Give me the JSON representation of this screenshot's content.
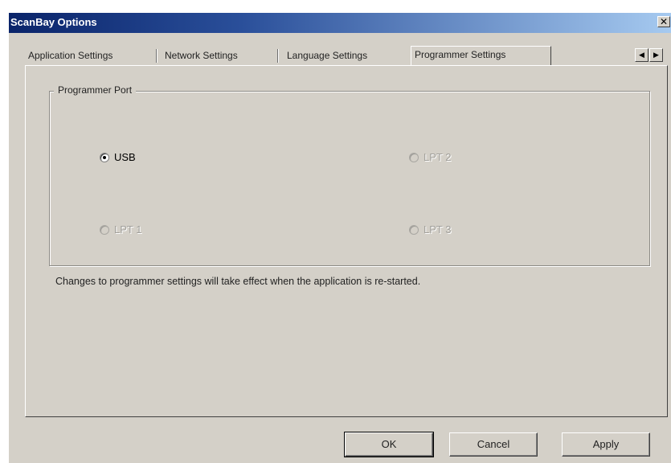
{
  "window": {
    "title": "ScanBay Options",
    "close_glyph": "✕"
  },
  "tabs": [
    {
      "label": "Application Settings",
      "active": false
    },
    {
      "label": "Network Settings",
      "active": false
    },
    {
      "label": "Language Settings",
      "active": false
    },
    {
      "label": "Programmer Settings",
      "active": true
    }
  ],
  "tab_scroll": {
    "left_glyph": "◀",
    "right_glyph": "▶"
  },
  "programmer_port": {
    "legend": "Programmer Port",
    "options": [
      {
        "label": "USB",
        "selected": true,
        "enabled": true
      },
      {
        "label": "LPT 2",
        "selected": false,
        "enabled": false
      },
      {
        "label": "LPT 1",
        "selected": false,
        "enabled": false
      },
      {
        "label": "LPT 3",
        "selected": false,
        "enabled": false
      }
    ]
  },
  "info_text": "Changes to programmer settings will take effect when the application is re-started.",
  "buttons": {
    "ok": "OK",
    "cancel": "Cancel",
    "apply": "Apply"
  },
  "colors": {
    "title_bar_start": "#0a246a",
    "title_bar_end": "#a6caf0",
    "face": "#d4d0c8"
  }
}
